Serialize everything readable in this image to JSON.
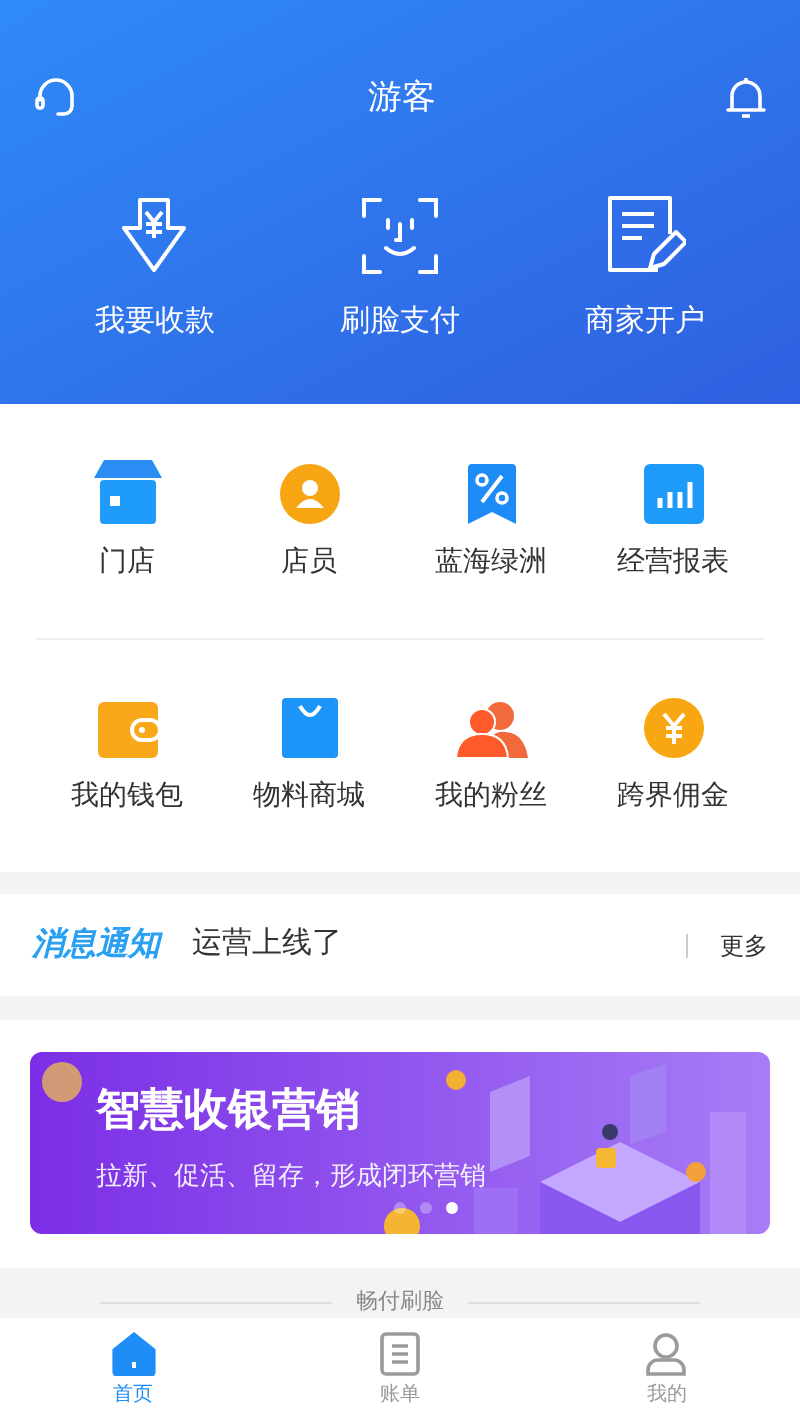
{
  "header": {
    "title": "游客"
  },
  "actions": [
    {
      "label": "我要收款"
    },
    {
      "label": "刷脸支付"
    },
    {
      "label": "商家开户"
    }
  ],
  "services": [
    [
      {
        "label": "门店"
      },
      {
        "label": "店员"
      },
      {
        "label": "蓝海绿洲"
      },
      {
        "label": "经营报表"
      }
    ],
    [
      {
        "label": "我的钱包"
      },
      {
        "label": "物料商城"
      },
      {
        "label": "我的粉丝"
      },
      {
        "label": "跨界佣金"
      }
    ]
  ],
  "notice": {
    "title": "消息通知",
    "message": "运营上线了",
    "more": "更多"
  },
  "banner": {
    "title": "智慧收银营销",
    "subtitle": "拉新、促活、留存，形成闭环营销",
    "dots": [
      {
        "selected": false
      },
      {
        "selected": false
      },
      {
        "selected": true
      }
    ]
  },
  "section": {
    "title": "畅付刷脸"
  },
  "tabs": [
    {
      "label": "首页",
      "selected": true
    },
    {
      "label": "账单",
      "selected": false
    },
    {
      "label": "我的",
      "selected": false
    }
  ]
}
